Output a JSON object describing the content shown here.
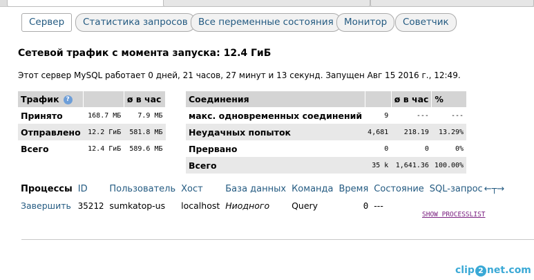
{
  "subtabs": [
    "Сервер",
    "Статистика запросов",
    "Все переменные состояния",
    "Монитор",
    "Советчик"
  ],
  "heading": "Сетевой трафик с момента запуска: 12.4 ГиБ",
  "uptime": "Этот сервер MySQL работает 0 дней, 21 часов, 27 минут и 13 секунд. Запущен Авг 15 2016 г., 12:49.",
  "traffic": {
    "header": [
      "Трафик",
      "",
      "ø в час"
    ],
    "rows": [
      {
        "label": "Принято",
        "total": "168.7 МБ",
        "per_hour": "7.9 МБ"
      },
      {
        "label": "Отправлено",
        "total": "12.2 ГиБ",
        "per_hour": "581.8 МБ"
      },
      {
        "label": "Всего",
        "total": "12.4 ГиБ",
        "per_hour": "589.6 МБ"
      }
    ]
  },
  "connections": {
    "header": [
      "Соединения",
      "",
      "ø в час",
      "%"
    ],
    "rows": [
      {
        "label": "макс. одновременных соединений",
        "total": "9",
        "per_hour": "---",
        "pct": "---"
      },
      {
        "label": "Неудачных попыток",
        "total": "4,681",
        "per_hour": "218.19",
        "pct": "13.29%"
      },
      {
        "label": "Прервано",
        "total": "0",
        "per_hour": "0",
        "pct": "0%"
      },
      {
        "label": "Всего",
        "total": "35 k",
        "per_hour": "1,641.36",
        "pct": "100.00%"
      }
    ]
  },
  "processes": {
    "header": [
      "Процессы",
      "ID",
      "Пользователь",
      "Хост",
      "База данных",
      "Команда",
      "Время",
      "Состояние",
      "SQL-запрос"
    ],
    "arrows": "←┬→",
    "rows": [
      {
        "action": "Завершить",
        "id": "35212",
        "user": "sumkatop-us",
        "host": "localhost",
        "db": "Ниодного",
        "command": "Query",
        "time": "0",
        "state": "---",
        "query": ""
      }
    ]
  },
  "show_processlist": "SHOW PROCESSLIST",
  "watermark": {
    "pre": "clip",
    "mid": "2",
    "post": "net.com"
  }
}
